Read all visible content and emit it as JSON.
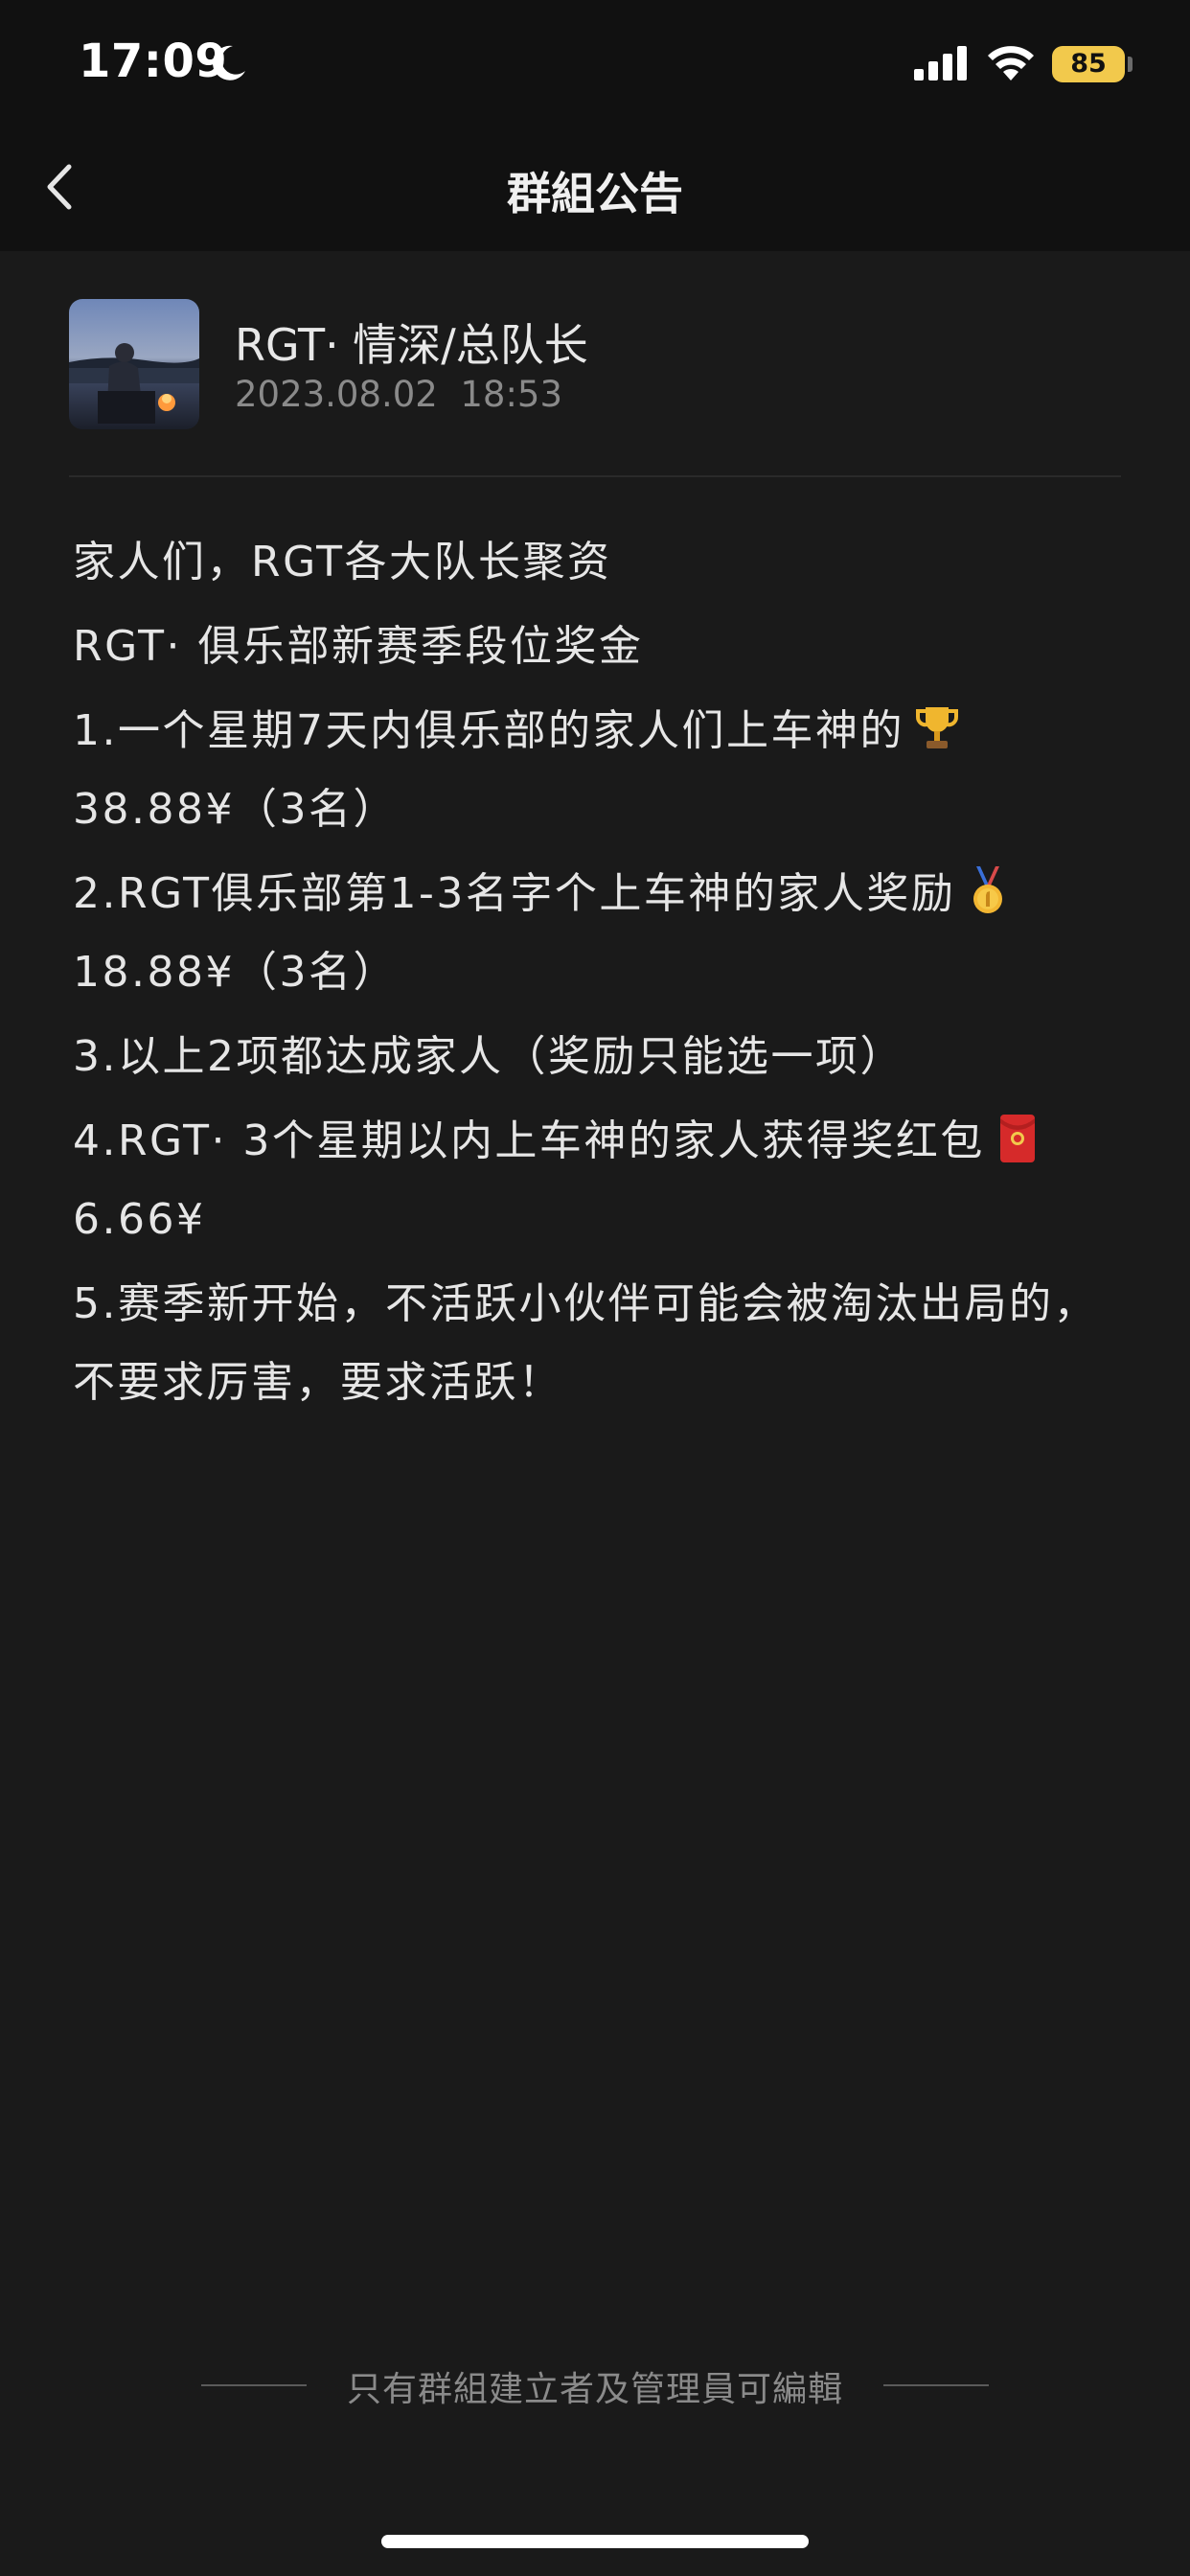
{
  "status_bar": {
    "time": "17:09",
    "battery": "85",
    "colors": {
      "battery": "#f2c94c"
    }
  },
  "nav": {
    "title": "群組公告",
    "back_icon": "chevron-left-icon"
  },
  "announcement": {
    "author_name": "RGT· 情深/总队长",
    "timestamp": "2023.08.02  18:53",
    "lines": [
      {
        "text": "家人们，RGT各大队长聚资"
      },
      {
        "text": "RGT· 俱乐部新赛季段位奖金"
      },
      {
        "text": "1.一个星期7天内俱乐部的家人们上车神的",
        "emoji": "trophy-icon",
        "text2": "38.88¥（3名）"
      },
      {
        "text": "2.RGT俱乐部第1-3名字个上车神的家人奖励",
        "emoji": "gold-medal-icon",
        "text2": "18.88¥（3名）"
      },
      {
        "text": "3.以上2项都达成家人（奖励只能选一项）"
      },
      {
        "text": "4.RGT· 3个星期以内上车神的家人获得奖红包",
        "emoji": "red-envelope-icon",
        "text2": "6.66¥"
      },
      {
        "text": "5.赛季新开始，不活跃小伙伴可能会被淘汰出局的，不要求厉害，要求活跃！"
      }
    ]
  },
  "footer": {
    "note": "只有群組建立者及管理員可編輯"
  }
}
